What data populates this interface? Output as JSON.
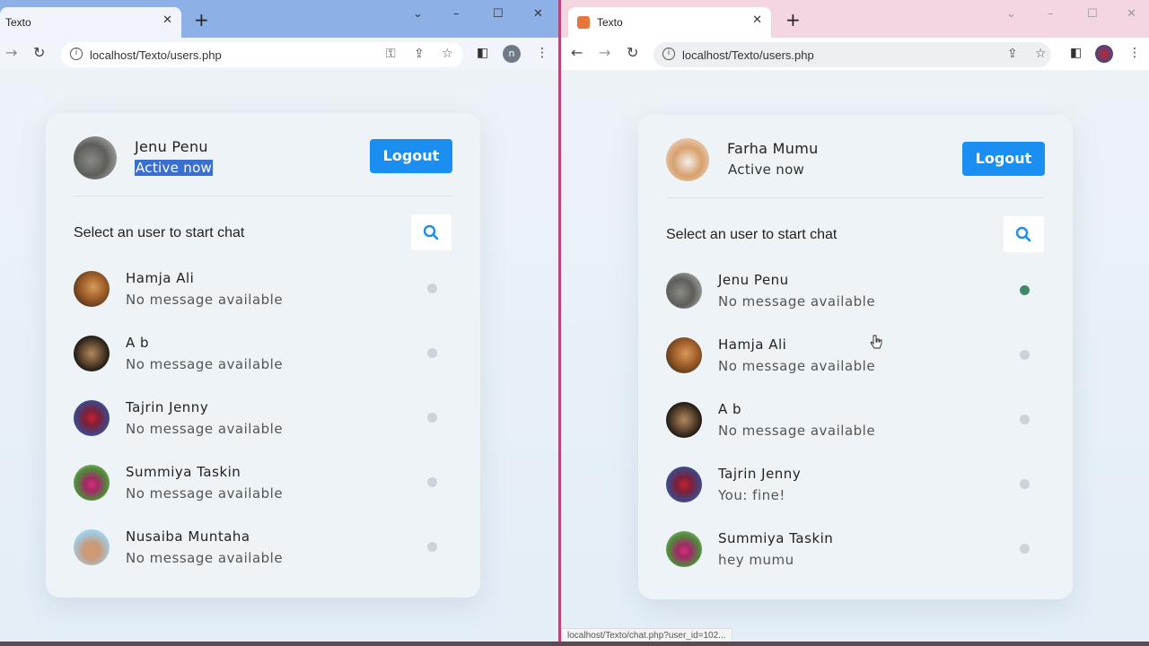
{
  "left_window": {
    "tab_title": "Texto",
    "url": "localhost/Texto/users.php",
    "profile_letter": "n",
    "me": {
      "name": "Jenu Penu",
      "status": "Active now"
    },
    "logout_label": "Logout",
    "search_placeholder": "Select an user to start chat",
    "users": [
      {
        "name": "Hamja Ali",
        "message": "No message available",
        "online": false
      },
      {
        "name": "A b",
        "message": "No message available",
        "online": false
      },
      {
        "name": "Tajrin Jenny",
        "message": "No message available",
        "online": false
      },
      {
        "name": "Summiya Taskin",
        "message": "No message available",
        "online": false
      },
      {
        "name": "Nusaiba Muntaha",
        "message": "No message available",
        "online": false
      }
    ]
  },
  "right_window": {
    "tab_title": "Texto",
    "url": "localhost/Texto/users.php",
    "me": {
      "name": "Farha Mumu",
      "status": "Active now"
    },
    "logout_label": "Logout",
    "search_placeholder": "Select an user to start chat",
    "users": [
      {
        "name": "Jenu Penu",
        "message": "No message available",
        "online": true
      },
      {
        "name": "Hamja Ali",
        "message": "No message available",
        "online": false
      },
      {
        "name": "A b",
        "message": "No message available",
        "online": false
      },
      {
        "name": "Tajrin Jenny",
        "message": "You: fine!",
        "online": false
      },
      {
        "name": "Summiya Taskin",
        "message": "hey mumu",
        "online": false
      }
    ],
    "status_url": "localhost/Texto/chat.php?user_id=102..."
  },
  "colors": {
    "accent": "#1a8ef1",
    "online": "#3f8a63",
    "offline": "#ccd3db",
    "selection": "#3a6fd0"
  }
}
